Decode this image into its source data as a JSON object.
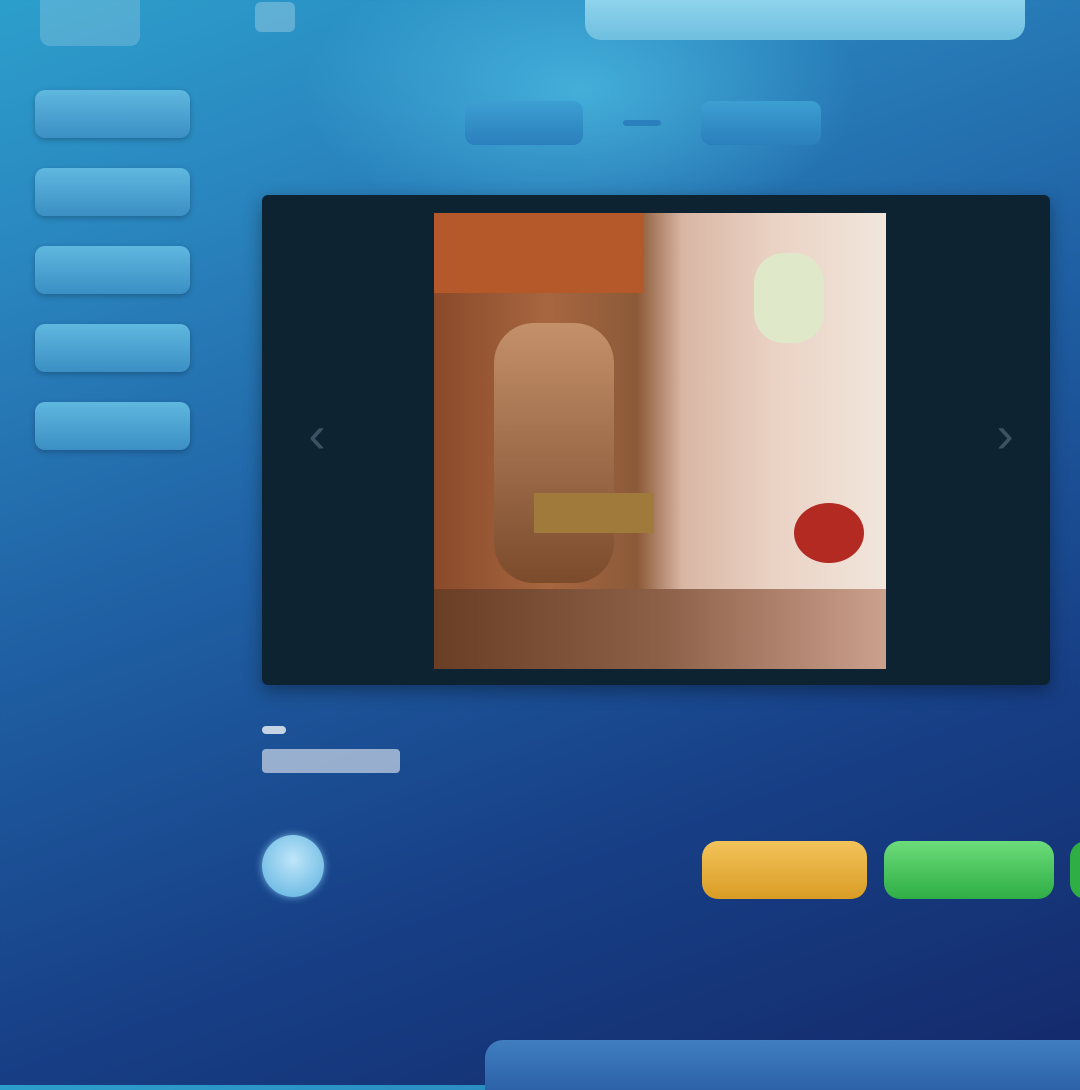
{
  "header": {
    "search_text": ""
  },
  "sidebar": {
    "items": [
      {
        "label": ""
      },
      {
        "label": ""
      },
      {
        "label": ""
      },
      {
        "label": ""
      },
      {
        "label": ""
      }
    ]
  },
  "tabs": [
    {
      "label": ""
    },
    {
      "label": ""
    }
  ],
  "player": {
    "prev_icon": "chevron-left-icon",
    "next_icon": "chevron-right-icon"
  },
  "video": {
    "title_strong": "",
    "title_rest": "",
    "title_sub": ""
  },
  "actions": {
    "views": "",
    "likes": "",
    "download_label": "",
    "share_label": ""
  },
  "footer": {
    "text": ""
  },
  "colors": {
    "accent_blue": "#2a86bf",
    "download_yellow": "#e0a830",
    "share_green": "#3bbf52",
    "stat_pink": "#d05a9c"
  }
}
